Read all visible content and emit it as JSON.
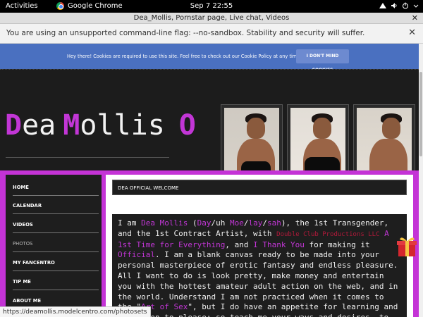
{
  "system": {
    "activities": "Activities",
    "app_name": "Google Chrome",
    "clock": "Sep 7  22:55",
    "tray": [
      "network-icon",
      "volume-icon",
      "power-icon",
      "menu-arrow-icon"
    ]
  },
  "window": {
    "title": "Dea_Mollis, Pornstar page, Live chat, Videos",
    "close_glyph": "✕"
  },
  "infobar": {
    "message": "You are using an unsupported command-line flag: --no-sandbox. Stability and security will suffer.",
    "close_glyph": "✕"
  },
  "cookie": {
    "text": "Hey there! Cookies are required to use this site. Feel free to check out our Cookie Policy at any time.",
    "button": "I DON'T MIND COOKIES"
  },
  "logo": {
    "part1_initial": "D",
    "part1_rest": "ea",
    "part2_initial": "M",
    "part2_rest": "ollis",
    "part3_initial": "O"
  },
  "nav": {
    "items": [
      {
        "label": "HOME"
      },
      {
        "label": "CALENDAR"
      },
      {
        "label": "VIDEOS"
      },
      {
        "label": "PHOTOS"
      },
      {
        "label": "MY FANCENTRO"
      },
      {
        "label": "TIP ME"
      },
      {
        "label": "ABOUT ME"
      }
    ]
  },
  "content": {
    "welcome": "DEA OFFICIAL WELCOME",
    "intro_a": "I am ",
    "name": "Dea Mollis",
    "intro_b": " (",
    "day": "Day",
    "sep1": "/uh ",
    "moe": "Moe",
    "sep2": "/",
    "lay": "lay",
    "sep3": "/",
    "sah": "sah",
    "intro_c": "), the 1st Transgender, and the 1st Contract Artist, with ",
    "studio": "Double Club Productions LLC",
    "intro_d": " ",
    "studio_link": "A 1st Time for Everything",
    "intro_e": ", and ",
    "thanks": "I Thank You",
    "intro_f": " for making it ",
    "official": "Official",
    "body": ". I am a blank canvas ready to be made into your personal masterpiece of erotic fantasy and endless pleasure. All I want to do is look pretty, make money and entertain you with the hottest amateur adult action on the web, and in the world. Understand I am not practiced when it comes to the \"",
    "art": "Art of Sex",
    "body2": "\", but I do have an appetite for learning and a passion to please; so teach me your ways and desires, to get a front"
  },
  "status_url": "https://deamollis.modelcentro.com/photosets",
  "colors": {
    "brand_magenta": "#c433d6",
    "cookie_blue": "#4a70c0"
  }
}
